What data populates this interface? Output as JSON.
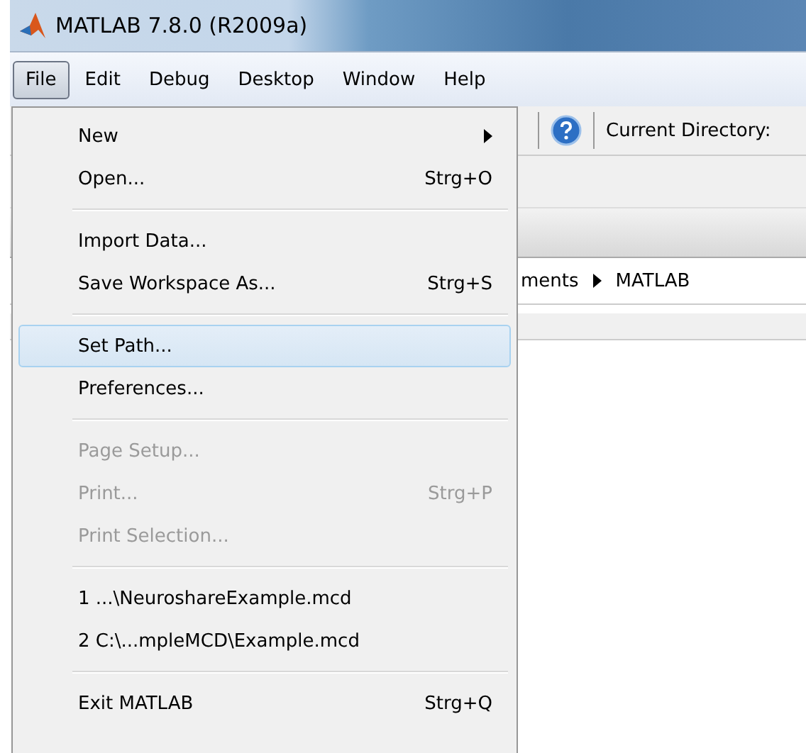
{
  "window": {
    "title": "MATLAB  7.8.0 (R2009a)"
  },
  "menu_bar": [
    {
      "label": "File",
      "selected": true
    },
    {
      "label": "Edit",
      "selected": false
    },
    {
      "label": "Debug",
      "selected": false
    },
    {
      "label": "Desktop",
      "selected": false
    },
    {
      "label": "Window",
      "selected": false
    },
    {
      "label": "Help",
      "selected": false
    }
  ],
  "toolbar": {
    "current_directory_label": "Current Directory:"
  },
  "path_bar": {
    "segments": [
      "ments",
      "MATLAB"
    ]
  },
  "file_menu": [
    {
      "kind": "item",
      "label": "New",
      "submenu": true,
      "selected": false,
      "disabled": false
    },
    {
      "kind": "item",
      "label": "Open...",
      "shortcut": "Strg+O",
      "selected": false,
      "disabled": false
    },
    {
      "kind": "separator"
    },
    {
      "kind": "item",
      "label": "Import Data...",
      "selected": false,
      "disabled": false
    },
    {
      "kind": "item",
      "label": "Save Workspace As...",
      "shortcut": "Strg+S",
      "selected": false,
      "disabled": false
    },
    {
      "kind": "separator"
    },
    {
      "kind": "item",
      "label": "Set Path...",
      "selected": true,
      "disabled": false
    },
    {
      "kind": "item",
      "label": "Preferences...",
      "selected": false,
      "disabled": false
    },
    {
      "kind": "separator"
    },
    {
      "kind": "item",
      "label": "Page Setup...",
      "selected": false,
      "disabled": true
    },
    {
      "kind": "item",
      "label": "Print...",
      "shortcut": "Strg+P",
      "selected": false,
      "disabled": true
    },
    {
      "kind": "item",
      "label": "Print Selection...",
      "selected": false,
      "disabled": true
    },
    {
      "kind": "separator"
    },
    {
      "kind": "item",
      "label": "1 ...\\NeuroshareExample.mcd",
      "selected": false,
      "disabled": false
    },
    {
      "kind": "item",
      "label": "2 C:\\...mpleMCD\\Example.mcd",
      "selected": false,
      "disabled": false
    },
    {
      "kind": "separator"
    },
    {
      "kind": "item",
      "label": "Exit MATLAB",
      "shortcut": "Strg+Q",
      "selected": false,
      "disabled": false
    }
  ]
}
